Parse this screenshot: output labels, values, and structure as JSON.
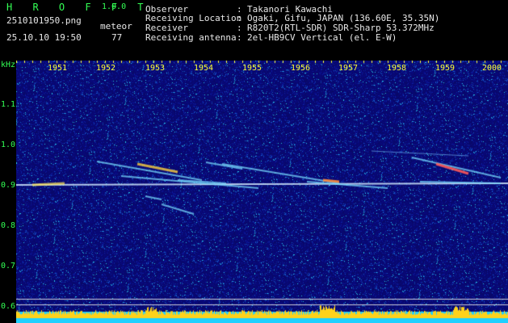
{
  "header": {
    "app_title": "H R O F F T",
    "version": "1.0.0",
    "filename": "2510101950.png",
    "meteor_label": "meteor",
    "datetime": "25.10.10 19:50",
    "meteor_count": "77",
    "info": [
      {
        "key": "Observer",
        "sep": ":",
        "value": "Takanori Kawachi"
      },
      {
        "key": "Receiving Location",
        "sep": ":",
        "value": "Ogaki, Gifu, JAPAN (136.60E, 35.35N)"
      },
      {
        "key": "Receiver",
        "sep": ":",
        "value": "R820T2(RTL-SDR) SDR-Sharp 53.372MHz"
      },
      {
        "key": "Receiving antenna",
        "sep": ":",
        "value": "2el-HB9CV Vertical (el. E-W)"
      }
    ]
  },
  "axes": {
    "y_unit": "kHz",
    "y_ticks": [
      "1.1",
      "1.0",
      "0.9",
      "0.8",
      "0.7",
      "0.6"
    ],
    "x_ticks": [
      "1951",
      "1952",
      "1953",
      "1954",
      "1955",
      "1956",
      "1957",
      "1958",
      "1959",
      "2000"
    ]
  },
  "colors": {
    "background": "#0a0a6e",
    "header_green": "#33ff55",
    "tick_yellow": "#ffff33",
    "carrier": "#cfe9ff"
  }
}
